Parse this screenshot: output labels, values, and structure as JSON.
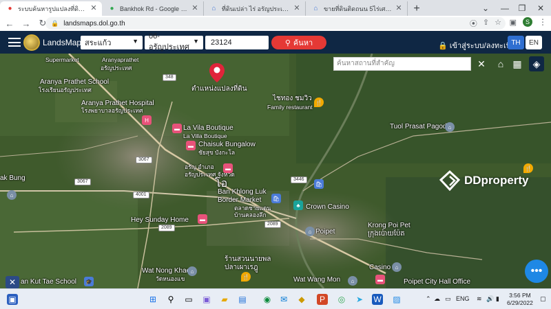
{
  "browser": {
    "tabs": [
      {
        "title": "ระบบค้นหารูปแปลงที่ดิน (LandsMaps",
        "active": true,
        "icon": "map-pin-icon",
        "color": "#e53935"
      },
      {
        "title": "Bankhok Rd - Google Maps",
        "active": false,
        "icon": "google-maps-icon",
        "color": "#34a853"
      },
      {
        "title": "ที่ดินเปล่า ไร่ อรัญประเทศ สระแก้ว ซื้อขาย",
        "active": false,
        "icon": "house-icon",
        "color": "#4a7bd8"
      },
      {
        "title": "ขายที่ดินติดถนน 5ไร่เศษ ห่างจากเขตแดน",
        "active": false,
        "icon": "house-icon",
        "color": "#4a7bd8"
      }
    ],
    "new_tab": "+",
    "url": "landsmaps.dol.go.th",
    "profile_initial": "S"
  },
  "app": {
    "brand": "LandsMaps",
    "province": "สระแก้ว",
    "district": "06-อรัญประเทศ",
    "parcel_number": "23124",
    "search_label": "ค้นหา",
    "login_label": "เข้าสู่ระบบ/ลงทะเบียน",
    "lang_th": "TH",
    "lang_en": "EN",
    "place_search_placeholder": "ค้นหาสถานที่สำคัญ"
  },
  "map": {
    "marker_label": "ตำแหน่งแปลงที่ดิน",
    "labels": {
      "supermarket": "Supermarket",
      "aranyaprathet_th": "อรัญประเทศ",
      "aranyaprathet_en": "Aranyaprathet",
      "school_en": "Aranya Prathet School",
      "school_th": "โรงเรียนอรัญประเทศ",
      "hospital_en": "Aranya Prathet Hospital",
      "hospital_th": "โรงพยาบาลอรัญประเทศ",
      "lavila_en": "La Vila Boutique",
      "lavila_th": "La Villa Boutique",
      "chaisuk_en": "Chaisuk Bungalow",
      "chaisuk_th": "ชัยสุข บังกะโล",
      "district_office": "อรัญ อำเภอ",
      "district_office2": "อรัญประเทศ จังหวัด",
      "symbol": "โอ",
      "border_market_en": "Ban Khlong Luk",
      "border_market_en2": "Border Market",
      "border_market_th": "ตลาดชายแดน",
      "border_market_th2": "บ้านคลองลึก",
      "sai_thong_th": "ไชทอง ชมวิว",
      "family_restaurant": "Family restaurant",
      "tuol_prasat": "Tuol Prasat Pagoda",
      "crown_casino": "Crown Casino",
      "poipet_en": "Poipet",
      "krong_poi_pet": "Krong Poi Pet",
      "krong_poi_pet_km": "ក្រុងប៉ោយប៉ែត",
      "hey_sunday": "Hey Sunday Home",
      "ban_bung": "ak Bung",
      "rest_th": "ร้านสวนนายพล",
      "rest_th2": "ปลาเผาเรฎู",
      "wat_nong_khae": "Wat Nong Khae",
      "wat_nong_khae_th": "วัดหนองแข",
      "kut_tae": "an Kut Tae School",
      "wat_wang_mon": "Wat Wang Mon",
      "casino": "Casino",
      "city_hall": "Poipet City Hall Office"
    },
    "road_shields": [
      "348",
      "3067",
      "3067",
      "4001",
      "2089",
      "2089",
      "3446",
      "4001"
    ],
    "watermark": "DDproperty"
  },
  "taskbar": {
    "lang": "ENG",
    "time": "3:56 PM",
    "date": "6/29/2022"
  }
}
